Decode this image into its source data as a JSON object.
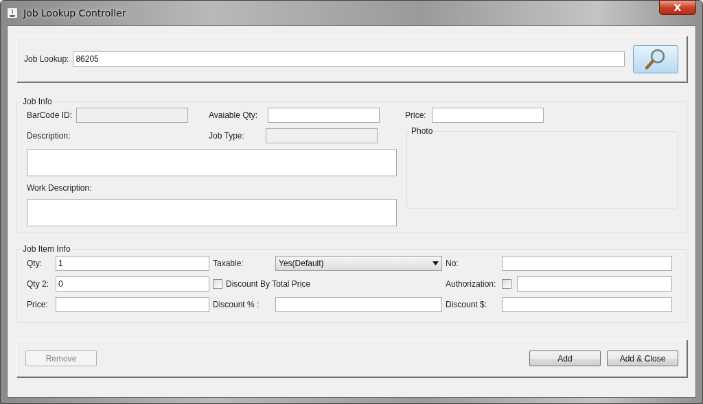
{
  "window": {
    "title": "Job Lookup Controller",
    "close": "X"
  },
  "lookup": {
    "label": "Job Lookup:",
    "value": "86205"
  },
  "job_info": {
    "title": "Job Info",
    "barcode": {
      "label": "BarCode ID:",
      "disabled": true
    },
    "available_qty": {
      "label": "Avaiable Qty:",
      "disabled": false
    },
    "price": {
      "label": "Price:",
      "disabled": false
    },
    "description": {
      "label": "Description:"
    },
    "job_type": {
      "label": "Job Type:",
      "disabled": true
    },
    "photo": {
      "title": "Photo"
    },
    "work_description": {
      "label": "Work Description:"
    }
  },
  "job_item_info": {
    "title": "Job Item Info",
    "cells": [
      {
        "kind": "field",
        "label": "Qty:",
        "value": "1"
      },
      {
        "kind": "dropdown",
        "label": "Taxable:",
        "value": "Yes(Default)"
      },
      {
        "kind": "field",
        "label": "No:"
      },
      {
        "kind": "field",
        "label": "Qty 2:",
        "value": "0"
      },
      {
        "kind": "checkbox",
        "label": "Discount By Total Price",
        "checked": false
      },
      {
        "kind": "check_field",
        "label": "Authorization:",
        "checked": false
      },
      {
        "kind": "field",
        "label": "Price:"
      },
      {
        "kind": "field",
        "label": "Discount % :"
      },
      {
        "kind": "field",
        "label": "Discount $:"
      }
    ]
  },
  "buttons": [
    {
      "label": "Remove",
      "disabled": true
    },
    {
      "label": "Add",
      "disabled": false
    },
    {
      "label": "Add & Close",
      "disabled": false
    }
  ]
}
